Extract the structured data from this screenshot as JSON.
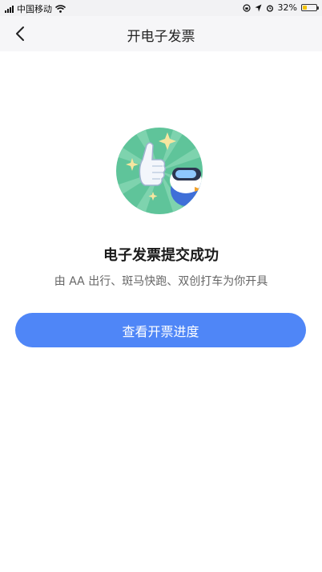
{
  "status": {
    "carrier": "中国移动",
    "battery_text": "32%",
    "battery_level": 0.32
  },
  "nav": {
    "title": "开电子发票",
    "back_icon": "chevron-left-icon"
  },
  "result": {
    "title": "电子发票提交成功",
    "subtitle": "由 AA 出行、斑马快跑、双创打车为你开具",
    "illustration": "thumbs-up-penguin-illustration"
  },
  "actions": {
    "view_progress": "查看开票进度"
  },
  "colors": {
    "primary": "#4f86f7",
    "illustration_bg": "#5fc49a"
  }
}
